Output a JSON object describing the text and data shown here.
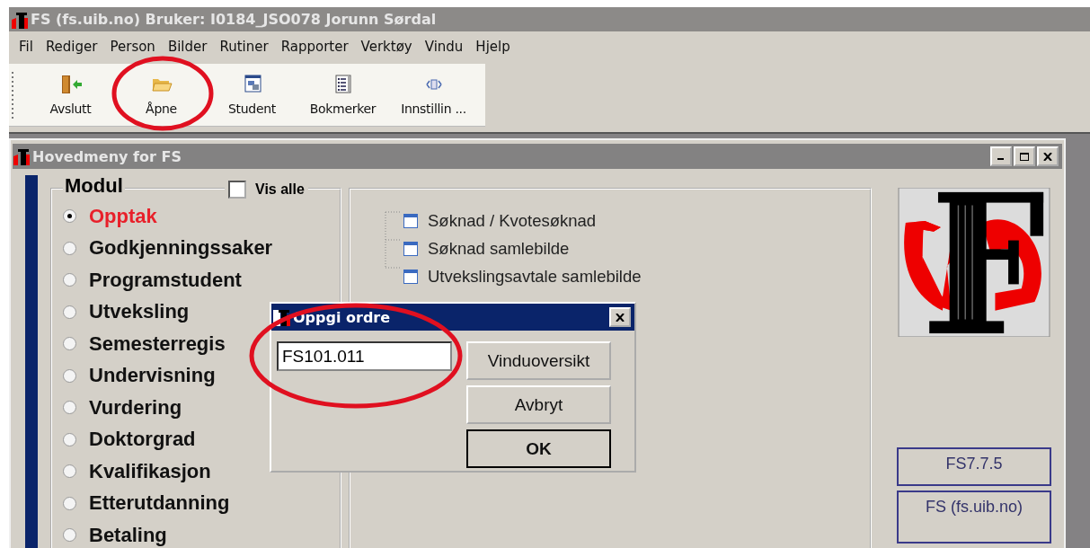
{
  "window": {
    "title": "FS (fs.uib.no) Bruker: I0184_JSO078 Jorunn Sørdal"
  },
  "menu": [
    "Fil",
    "Rediger",
    "Person",
    "Bilder",
    "Rutiner",
    "Rapporter",
    "Verktøy",
    "Vindu",
    "Hjelp"
  ],
  "toolbar": [
    {
      "label": "Avslutt",
      "kind": "exit"
    },
    {
      "label": "Åpne",
      "kind": "open"
    },
    {
      "label": "Student",
      "kind": "student"
    },
    {
      "label": "Bokmerker",
      "kind": "bookmarks"
    },
    {
      "label": "Innstillin ...",
      "kind": "settings"
    }
  ],
  "child_window": {
    "title": "Hovedmeny for FS",
    "modul": {
      "title": "Modul",
      "show_all": {
        "label": "Vis alle",
        "checked": false
      },
      "items": [
        {
          "label": "Opptak",
          "selected": true
        },
        {
          "label": "Godkjenningssaker",
          "selected": false
        },
        {
          "label": "Programstudent",
          "selected": false
        },
        {
          "label": "Utveksling",
          "selected": false
        },
        {
          "label": "Semesterregis",
          "selected": false
        },
        {
          "label": "Undervisning",
          "selected": false
        },
        {
          "label": "Vurdering",
          "selected": false
        },
        {
          "label": "Doktorgrad",
          "selected": false
        },
        {
          "label": "Kvalifikasjon",
          "selected": false
        },
        {
          "label": "Etterutdanning",
          "selected": false
        },
        {
          "label": "Betaling",
          "selected": false
        }
      ]
    },
    "tree": [
      "Søknad / Kvotesøknad",
      "Søknad samlebilde",
      "Utvekslingsavtale samlebilde"
    ],
    "version": "FS7.7.5",
    "server": "FS (fs.uib.no)"
  },
  "dialog": {
    "title": "Oppgi ordre",
    "command": "FS101.011",
    "buttons": [
      {
        "label": "Vinduoversikt",
        "default": false
      },
      {
        "label": "Avbryt",
        "default": false
      },
      {
        "label": "OK",
        "default": true
      }
    ]
  }
}
